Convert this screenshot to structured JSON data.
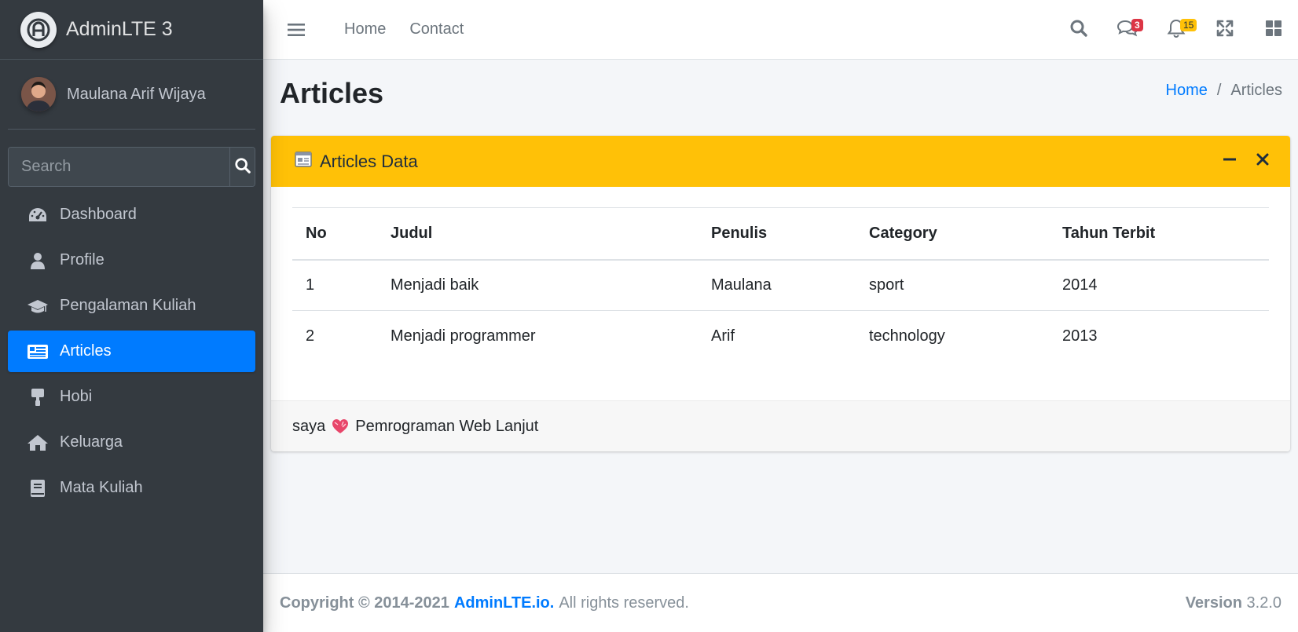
{
  "brand": {
    "name": "AdminLTE 3",
    "logo_icon": "adminlte-logo-icon"
  },
  "user": {
    "name": "Maulana Arif Wijaya"
  },
  "sidebar_search": {
    "placeholder": "Search",
    "value": ""
  },
  "nav": {
    "items": [
      {
        "label": "Dashboard",
        "icon": "tachometer-icon",
        "active": false
      },
      {
        "label": "Profile",
        "icon": "user-icon",
        "active": false
      },
      {
        "label": "Pengalaman Kuliah",
        "icon": "graduation-cap-icon",
        "active": false
      },
      {
        "label": "Articles",
        "icon": "newspaper-icon",
        "active": true
      },
      {
        "label": "Hobi",
        "icon": "paint-roller-icon",
        "active": false
      },
      {
        "label": "Keluarga",
        "icon": "home-icon",
        "active": false
      },
      {
        "label": "Mata Kuliah",
        "icon": "book-icon",
        "active": false
      }
    ]
  },
  "topbar": {
    "links": [
      "Home",
      "Contact"
    ],
    "messages_badge": "3",
    "notifications_badge": "15"
  },
  "page": {
    "title": "Articles",
    "breadcrumb": {
      "home": "Home",
      "separator": "/",
      "current": "Articles"
    }
  },
  "card": {
    "title": "Articles Data",
    "table": {
      "headers": [
        "No",
        "Judul",
        "Penulis",
        "Category",
        "Tahun Terbit"
      ],
      "rows": [
        [
          "1",
          "Menjadi baik",
          "Maulana",
          "sport",
          "2014"
        ],
        [
          "2",
          "Menjadi programmer",
          "Arif",
          "technology",
          "2013"
        ]
      ]
    },
    "footer": {
      "before": "saya",
      "after": "Pemrograman Web Lanjut"
    }
  },
  "footer": {
    "copyright": "Copyright © 2014-2021",
    "brand_link": "AdminLTE.io.",
    "rights": "All rights reserved.",
    "version_label": "Version",
    "version_value": "3.2.0"
  },
  "colors": {
    "sidebar_bg": "#343a40",
    "active_nav": "#007bff",
    "card_header": "#ffc107",
    "badge_danger": "#dc3545",
    "badge_warning": "#ffc107",
    "link": "#007bff"
  }
}
